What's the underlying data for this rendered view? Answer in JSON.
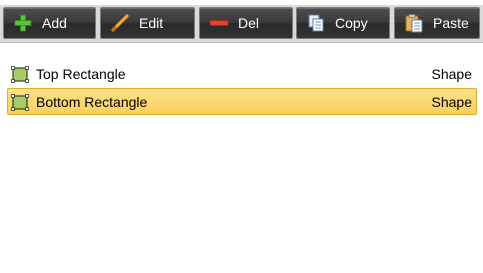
{
  "toolbar": {
    "buttons": [
      {
        "label": "Add",
        "icon": "plus-icon"
      },
      {
        "label": "Edit",
        "icon": "pencil-icon"
      },
      {
        "label": "Del",
        "icon": "minus-icon"
      },
      {
        "label": "Copy",
        "icon": "copy-icon"
      },
      {
        "label": "Paste",
        "icon": "paste-icon"
      }
    ]
  },
  "list": {
    "items": [
      {
        "name": "Top Rectangle",
        "type": "Shape",
        "icon": "shape-rectangle-icon",
        "selected": false
      },
      {
        "name": "Bottom Rectangle",
        "type": "Shape",
        "icon": "shape-rectangle-icon",
        "selected": true
      }
    ]
  },
  "colors": {
    "toolbar_bg": "#d9d9d9",
    "button_bg": "#3a3a3a",
    "selection_bg": "#f8cf5a",
    "selection_border": "#e0ad2c",
    "add_icon": "#5cc33a",
    "edit_icon": "#f2a23a",
    "del_icon": "#e0452a"
  }
}
